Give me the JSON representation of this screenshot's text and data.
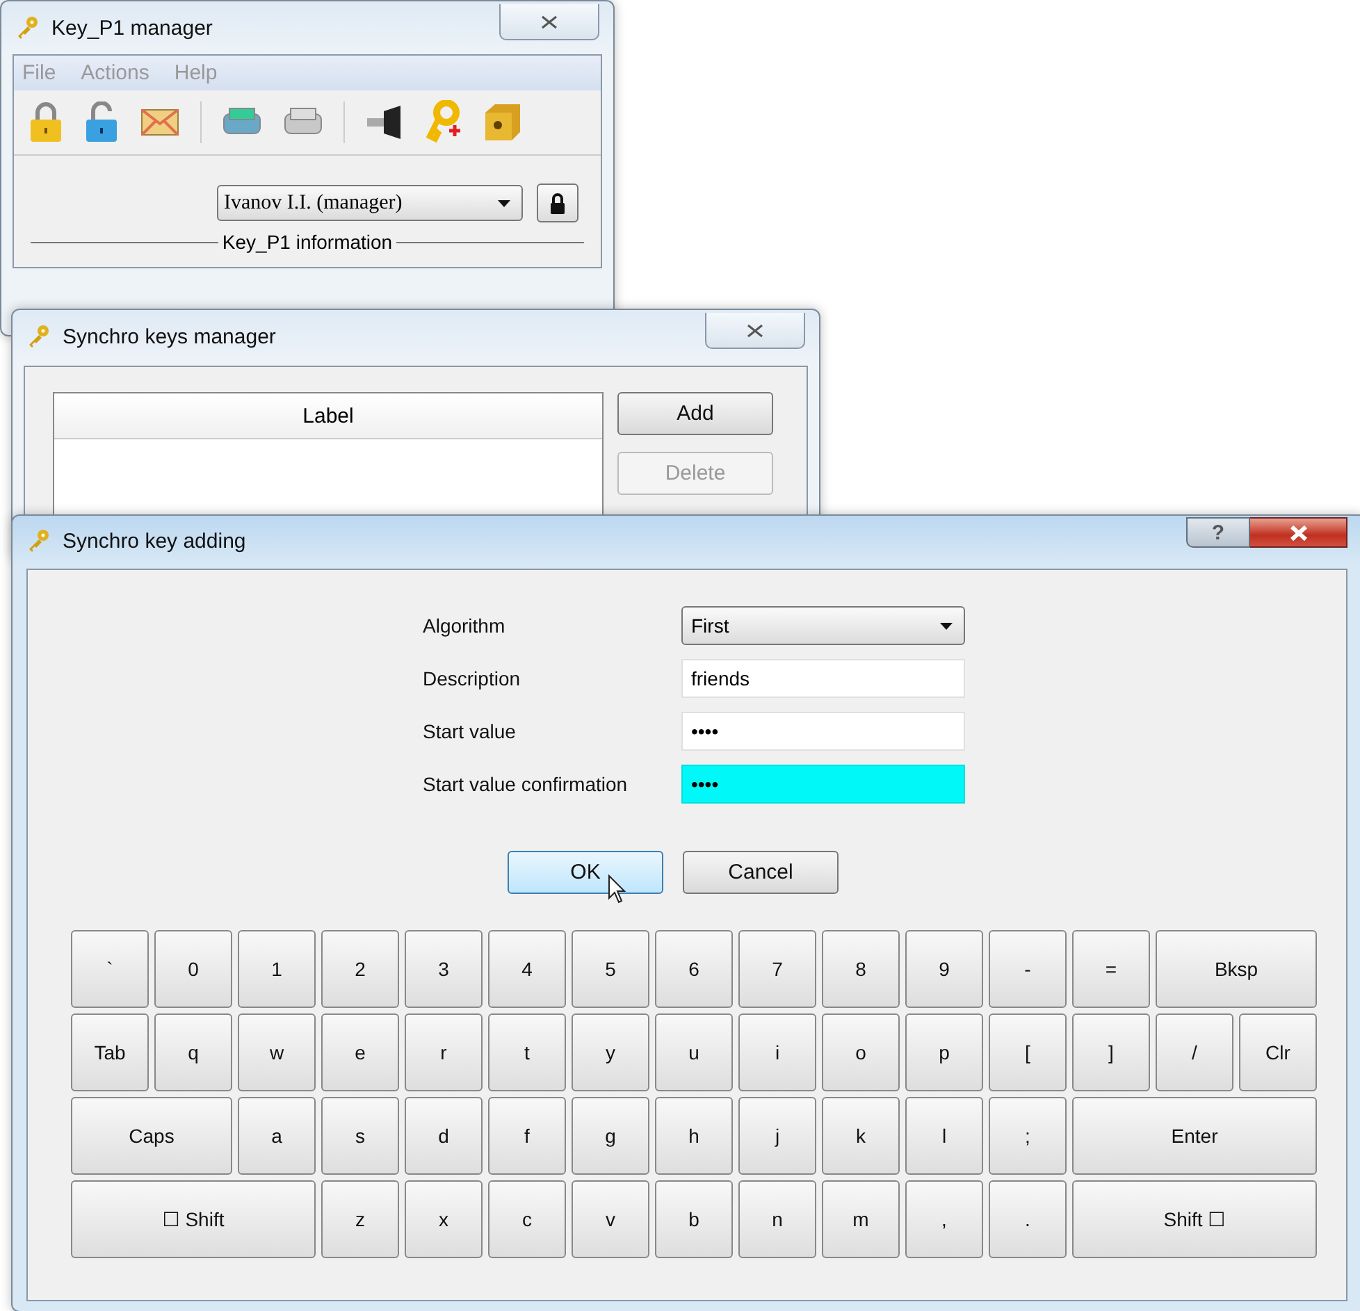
{
  "manager_window": {
    "title": "Key_P1 manager",
    "menu": [
      "File",
      "Actions",
      "Help"
    ],
    "toolbar_groups": [
      [
        {
          "kind": "lock"
        },
        {
          "kind": "unlock"
        },
        {
          "kind": "mail"
        }
      ],
      [
        {
          "kind": "drive"
        },
        {
          "kind": "drive-grey"
        }
      ],
      [
        {
          "kind": "reader"
        },
        {
          "kind": "key-add"
        },
        {
          "kind": "safe"
        }
      ]
    ],
    "user_select": {
      "value": "Ivanov I.I. (manager)"
    },
    "group_title": "Key_P1 information"
  },
  "keys_window": {
    "title": "Synchro keys manager",
    "table": {
      "columns": [
        "Label"
      ]
    },
    "buttons": [
      {
        "label": "Add",
        "disabled": false
      },
      {
        "label": "Delete",
        "disabled": true
      }
    ]
  },
  "adding_dialog": {
    "title": "Synchro key adding",
    "help_button": "?",
    "fields": [
      {
        "kind": "select",
        "label": "Algorithm",
        "value": "First",
        "focused": false
      },
      {
        "kind": "text",
        "label": "Description",
        "value": "friends",
        "focused": false
      },
      {
        "kind": "text",
        "label": "Start value",
        "value": "••••",
        "focused": false
      },
      {
        "kind": "text",
        "label": "Start value confirmation",
        "value": "••••",
        "focused": true
      }
    ],
    "buttons": [
      {
        "label": "OK",
        "default": true
      },
      {
        "label": "Cancel",
        "default": false
      }
    ],
    "keyboard": [
      [
        {
          "label": "`",
          "kind": "key"
        },
        {
          "label": "0",
          "kind": "key"
        },
        {
          "label": "1",
          "kind": "key"
        },
        {
          "label": "2",
          "kind": "key"
        },
        {
          "label": "3",
          "kind": "key"
        },
        {
          "label": "4",
          "kind": "key"
        },
        {
          "label": "5",
          "kind": "key"
        },
        {
          "label": "6",
          "kind": "key"
        },
        {
          "label": "7",
          "kind": "key"
        },
        {
          "label": "8",
          "kind": "key"
        },
        {
          "label": "9",
          "kind": "key"
        },
        {
          "label": "-",
          "kind": "key"
        },
        {
          "label": "=",
          "kind": "key"
        },
        {
          "label": "Bksp",
          "kind": "wide"
        }
      ],
      [
        {
          "label": "Tab",
          "kind": "key"
        },
        {
          "label": "q",
          "kind": "key"
        },
        {
          "label": "w",
          "kind": "key"
        },
        {
          "label": "e",
          "kind": "key"
        },
        {
          "label": "r",
          "kind": "key"
        },
        {
          "label": "t",
          "kind": "key"
        },
        {
          "label": "y",
          "kind": "key"
        },
        {
          "label": "u",
          "kind": "key"
        },
        {
          "label": "i",
          "kind": "key"
        },
        {
          "label": "o",
          "kind": "key"
        },
        {
          "label": "p",
          "kind": "key"
        },
        {
          "label": "[",
          "kind": "key"
        },
        {
          "label": "]",
          "kind": "key"
        },
        {
          "label": "/",
          "kind": "key"
        },
        {
          "label": "Clr",
          "kind": "key"
        }
      ],
      [
        {
          "label": "Caps",
          "kind": "wide"
        },
        {
          "label": "a",
          "kind": "key"
        },
        {
          "label": "s",
          "kind": "key"
        },
        {
          "label": "d",
          "kind": "key"
        },
        {
          "label": "f",
          "kind": "key"
        },
        {
          "label": "g",
          "kind": "key"
        },
        {
          "label": "h",
          "kind": "key"
        },
        {
          "label": "j",
          "kind": "key"
        },
        {
          "label": "k",
          "kind": "key"
        },
        {
          "label": "l",
          "kind": "key"
        },
        {
          "label": ";",
          "kind": "key"
        },
        {
          "label": "Enter",
          "kind": "extra-wide"
        }
      ],
      [
        {
          "label": "☐ Shift",
          "kind": "extra-wide"
        },
        {
          "label": "z",
          "kind": "key"
        },
        {
          "label": "x",
          "kind": "key"
        },
        {
          "label": "c",
          "kind": "key"
        },
        {
          "label": "v",
          "kind": "key"
        },
        {
          "label": "b",
          "kind": "key"
        },
        {
          "label": "n",
          "kind": "key"
        },
        {
          "label": "m",
          "kind": "key"
        },
        {
          "label": ",",
          "kind": "key"
        },
        {
          "label": ".",
          "kind": "key"
        },
        {
          "label": "Shift ☐",
          "kind": "extra-wide"
        }
      ]
    ]
  }
}
